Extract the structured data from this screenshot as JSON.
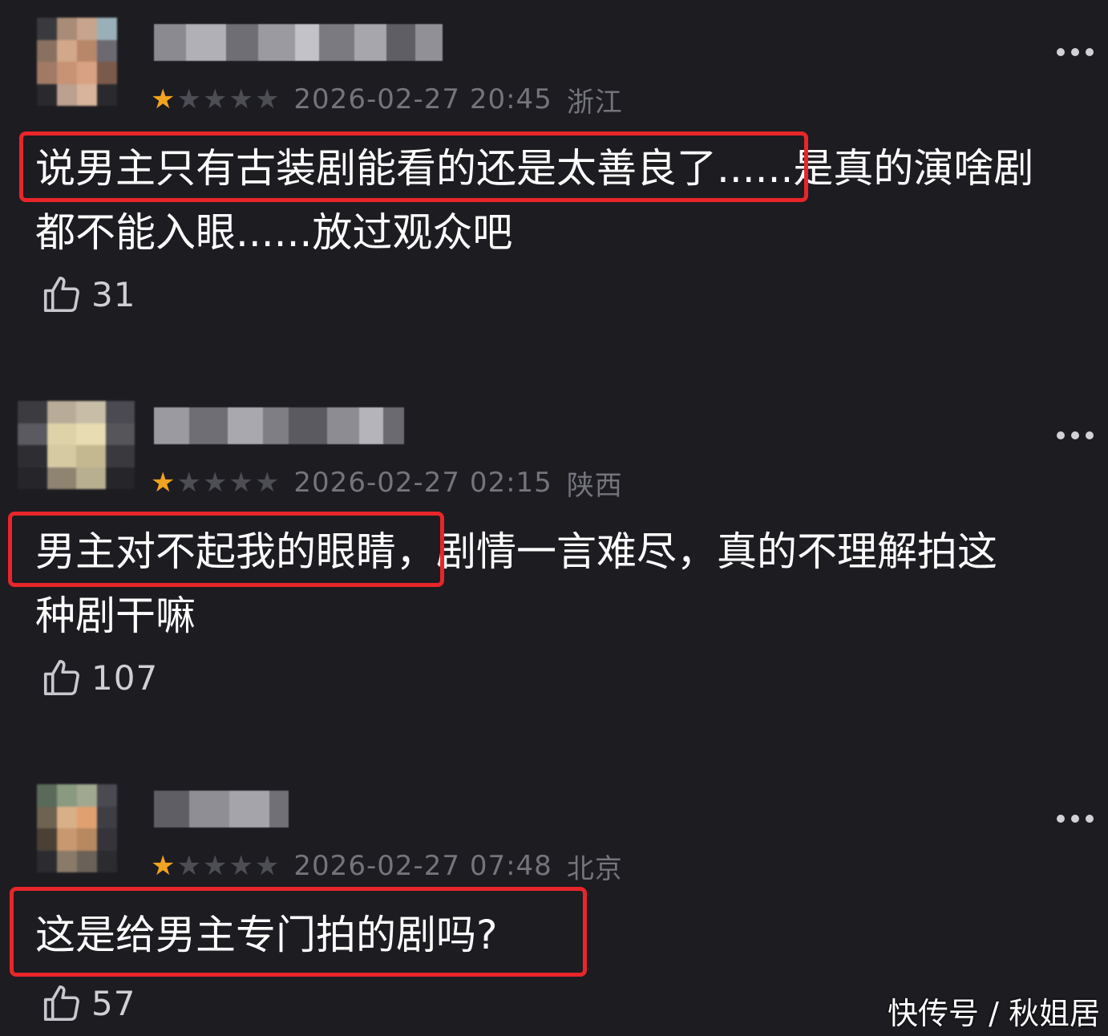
{
  "comments": [
    {
      "rating": 1,
      "date": "2026-02-27 20:45",
      "location": "浙江",
      "text_line1": "说男主只有古装剧能看的还是太善良了......是真的演啥剧",
      "text_line2": "都不能入眼......放过观众吧",
      "likes": "31"
    },
    {
      "rating": 1,
      "date": "2026-02-27 02:15",
      "location": "陕西",
      "text_line1": "男主对不起我的眼睛，剧情一言难尽，真的不理解拍这",
      "text_line2": "种剧干嘛",
      "likes": "107"
    },
    {
      "rating": 1,
      "date": "2026-02-27 07:48",
      "location": "北京",
      "text_line1": "这是给男主专门拍的剧吗?",
      "text_line2": "",
      "likes": "57"
    }
  ],
  "watermark": "快传号 / 秋姐居",
  "colors": {
    "background": "#1c1c21",
    "highlight_border": "#e8262a",
    "star_active": "#f2a31f",
    "star_inactive": "#4d4d54"
  }
}
